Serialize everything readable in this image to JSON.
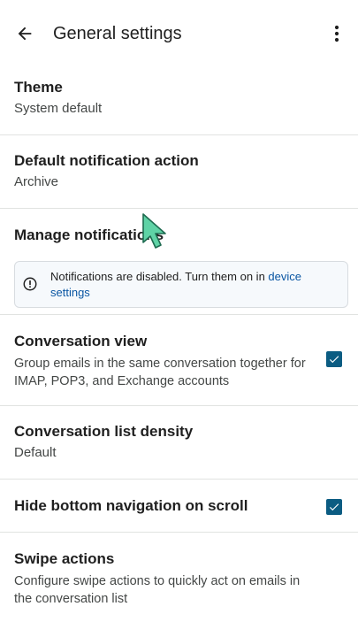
{
  "app_bar": {
    "title": "General settings",
    "back_icon": "arrow-back-icon",
    "more_icon": "more-vert-icon"
  },
  "settings": {
    "theme": {
      "title": "Theme",
      "value": "System default"
    },
    "default_notification_action": {
      "title": "Default notification action",
      "value": "Archive"
    },
    "manage_notifications": {
      "title": "Manage notifications",
      "banner": {
        "icon": "info-icon",
        "text": "Notifications are disabled. Turn them on in ",
        "link": "device settings"
      }
    },
    "conversation_view": {
      "title": "Conversation view",
      "description": "Group emails in the same conversation together for IMAP, POP3, and Exchange accounts",
      "checked": true
    },
    "conversation_list_density": {
      "title": "Conversation list density",
      "value": "Default"
    },
    "hide_bottom_navigation": {
      "title": "Hide bottom navigation on scroll",
      "checked": true
    },
    "swipe_actions": {
      "title": "Swipe actions",
      "description": "Configure swipe actions to quickly act on emails in the conversation list"
    }
  },
  "colors": {
    "accent": "#0b5c82",
    "link": "#0a56a3",
    "banner_bg": "#f6f9fc",
    "cursor": "#5fd3a6"
  }
}
